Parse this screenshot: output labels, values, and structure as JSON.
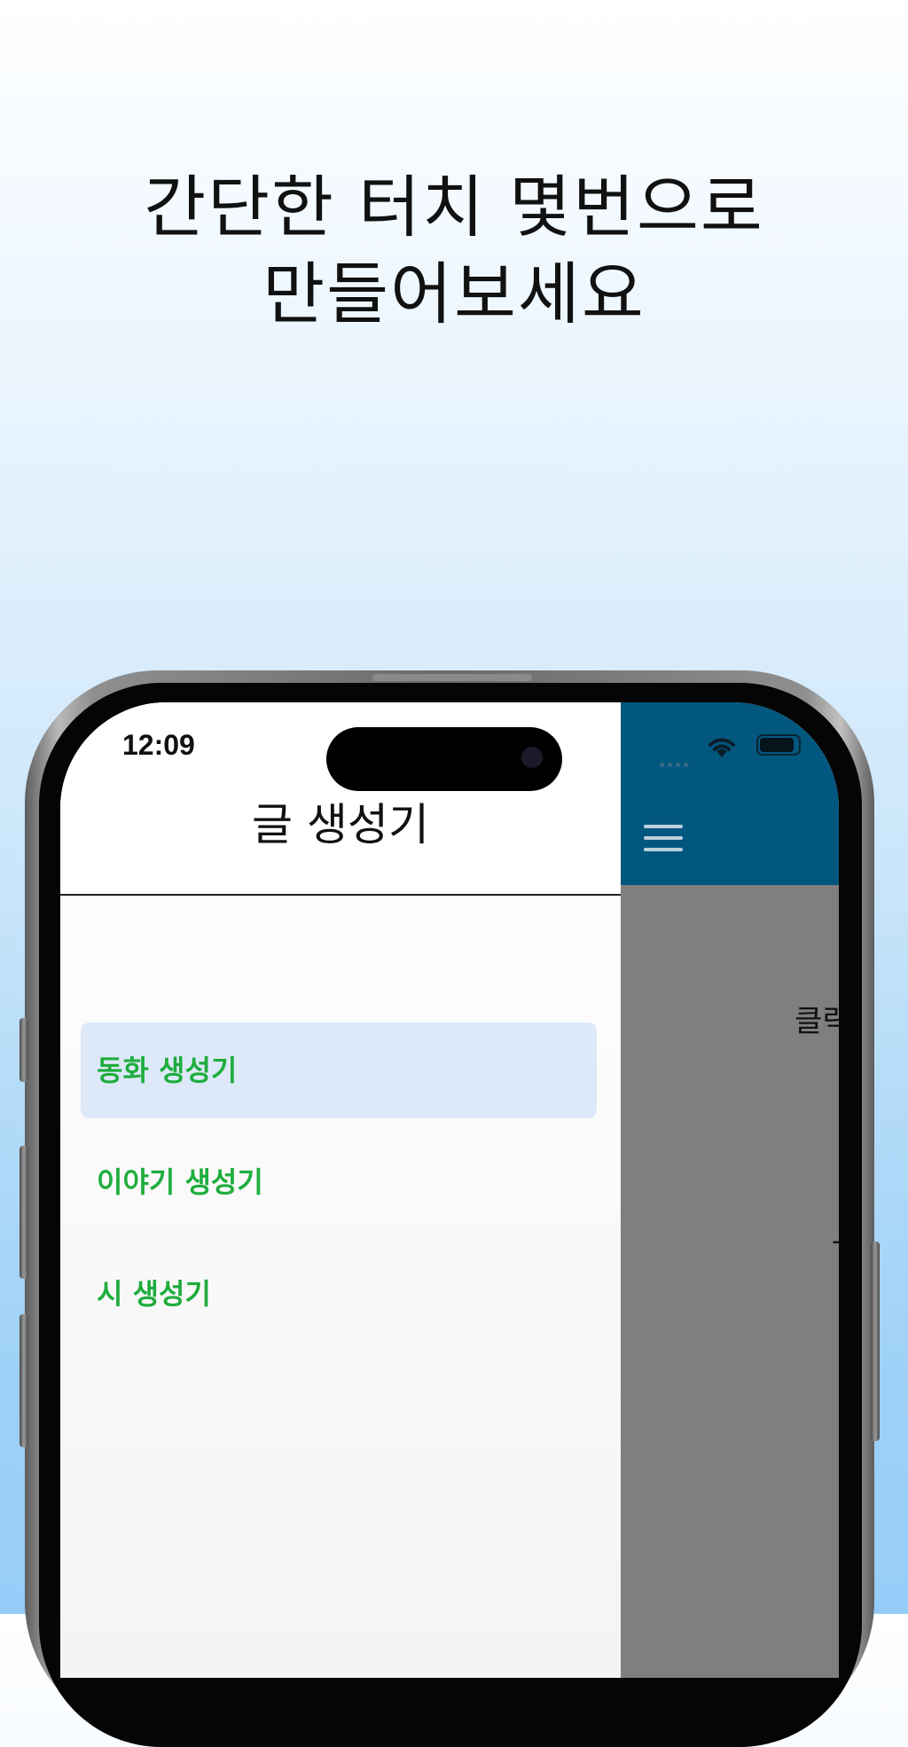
{
  "headline": {
    "line1": "간단한 터치 몇번으로",
    "line2": "만들어보세요"
  },
  "status_bar": {
    "time": "12:09"
  },
  "drawer": {
    "title": "글 생성기",
    "items": [
      {
        "label": "동화 생성기",
        "selected": true
      },
      {
        "label": "이야기 생성기",
        "selected": false
      },
      {
        "label": "시 생성기",
        "selected": false
      }
    ]
  },
  "app": {
    "peek_text": "클릭",
    "peek_dash": "-"
  },
  "colors": {
    "appbar": "#02577f",
    "accent_text": "#1fad3d",
    "selected_bg": "#dde9f8",
    "overlay": "#7f7f7f"
  }
}
